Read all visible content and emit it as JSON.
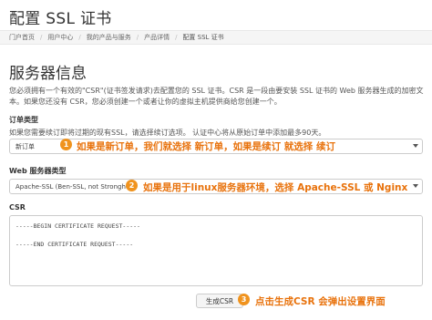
{
  "page": {
    "title": "配置 SSL 证书"
  },
  "breadcrumb": [
    {
      "label": "门户首页"
    },
    {
      "label": "用户中心"
    },
    {
      "label": "我的产品与服务"
    },
    {
      "label": "产品详情"
    },
    {
      "label": "配置 SSL 证书"
    }
  ],
  "section": {
    "title": "服务器信息",
    "description": "您必须拥有一个有效的\"CSR\"(证书签发请求)去配置您的 SSL 证书。CSR 是一段由要安装 SSL 证书的 Web 服务器生成的加密文本。如果您还没有 CSR，您必须创建一个或者让你的虚拟主机提供商给您创建一个。"
  },
  "order_type": {
    "label": "订单类型",
    "help": "如果您需要续订即将过期的现有SSL，请选择续订选项。 认证中心将从原始订单中添加最多90天。",
    "selected": "新订单"
  },
  "server_type": {
    "label": "Web 服务器类型",
    "selected": "Apache-SSL (Ben-SSL, not Stronghold)"
  },
  "csr": {
    "label": "CSR",
    "begin": "-----BEGIN CERTIFICATE REQUEST-----",
    "end": "-----END CERTIFICATE REQUEST-----"
  },
  "generate_button": {
    "label": "生成CSR"
  },
  "annotations": [
    {
      "num": "1",
      "text": "如果是新订单，我们就选择 新订单，如果是续订 就选择 续订"
    },
    {
      "num": "2",
      "text": "如果是用于linux服务器环境，选择 Apache-SSL 或 Nginx"
    },
    {
      "num": "3",
      "text": "点击生成CSR 会弹出设置界面"
    }
  ],
  "colors": {
    "annotation": "#e8720c",
    "badge": "#f0931e"
  }
}
